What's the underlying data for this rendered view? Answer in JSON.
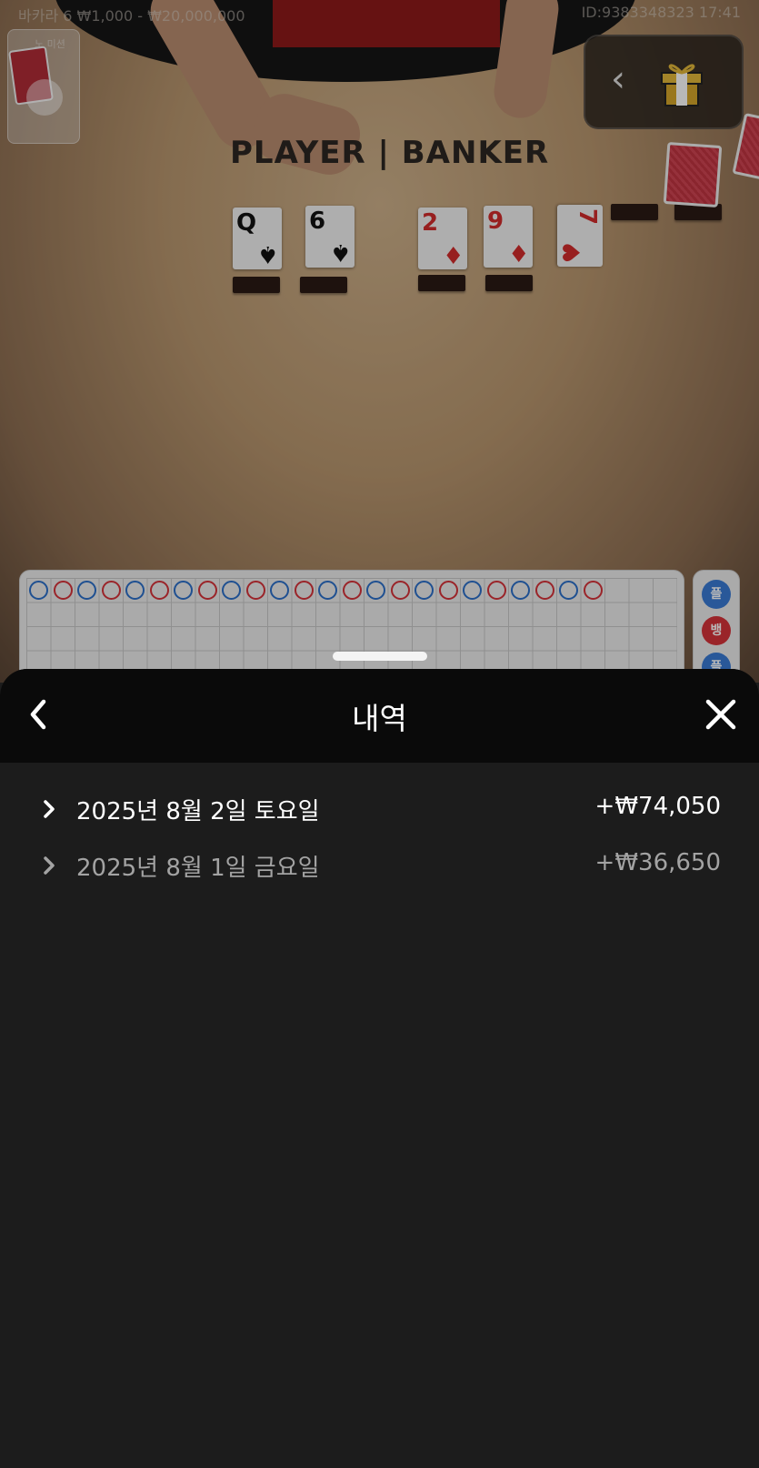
{
  "status_bar": {
    "table_info": "바카라 6  ₩1,000 - ₩20,000,000",
    "session_info": "ID:9383348323  17:41"
  },
  "shoe": {
    "label": "노 미션"
  },
  "table_felt": {
    "title": "PLAYER | BANKER"
  },
  "cards": {
    "player": [
      {
        "rank": "Q",
        "suit": "♠",
        "color": "black"
      },
      {
        "rank": "6",
        "suit": "♠",
        "color": "black"
      }
    ],
    "banker": [
      {
        "rank": "2",
        "suit": "♦",
        "color": "red"
      },
      {
        "rank": "9",
        "suit": "♦",
        "color": "red"
      },
      {
        "rank": "7",
        "suit": "♥",
        "color": "red"
      }
    ]
  },
  "gift_widget": {
    "icon": "gift-icon",
    "back_icon": "chevron-left-icon"
  },
  "roadmap": {
    "bead_row": [
      "b",
      "r",
      "b",
      "r",
      "b",
      "r",
      "b",
      "r",
      "b",
      "r",
      "b",
      "r",
      "b",
      "r",
      "b",
      "r",
      "b",
      "r",
      "b",
      "r",
      "b",
      "r",
      "b",
      "r"
    ],
    "side_labels": [
      "플",
      "뱅",
      "플"
    ],
    "side_colors": [
      "#3a7bd5",
      "#d6333a",
      "#3a7bd5"
    ],
    "colors": {
      "player": "#2c6fc9",
      "banker": "#d6333a"
    }
  },
  "sheet": {
    "title": "내역",
    "back_icon": "chevron-left-icon",
    "close_icon": "close-icon",
    "history": [
      {
        "date": "2025년 8월 2일 토요일",
        "amount": "+₩74,050",
        "state": "active"
      },
      {
        "date": "2025년 8월 1일 금요일",
        "amount": "+₩36,650",
        "state": "dim"
      }
    ]
  }
}
